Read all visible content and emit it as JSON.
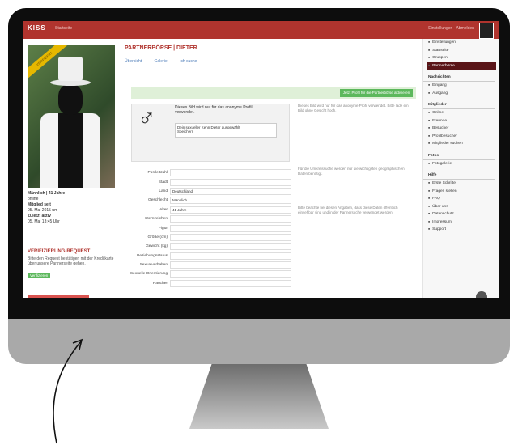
{
  "topbar": {
    "logo": "KISS",
    "nav": "Startseite",
    "right": "Einstellungen · Abmelden"
  },
  "profile": {
    "ribbon": "VERIFIZIERT",
    "meta": [
      {
        "label": "Männlich | 41 Jahre",
        "value": "online"
      },
      {
        "label": "Mitglied seit",
        "value": "05. Mai 2015 um"
      },
      {
        "label": "Zuletzt aktiv",
        "value": "05. Mai 13:45 Uhr"
      }
    ],
    "verification": {
      "title": "VERIFIZIERUNG-REQUEST",
      "text": "Bitte den Request bestätigen mit der Kreditkarte über unsere Partnerseite gehen.",
      "button": "Verifizieren"
    }
  },
  "main": {
    "title": "PARTNERBÖRSE | DIETER",
    "tabs": [
      "Übersicht",
      "Galerie",
      "Ich suche"
    ],
    "green_button": "Jetzt Profil für die Partnerbörse aktivieren",
    "anon_text": "Dieses Bild wird nur für das anonyme Profil verwendet.",
    "tagline": "Dein sexueller Kenn Dieter ausgewählt",
    "tagline_sub": "Speichern",
    "help": [
      "Dieses Bild wird nur für das anonyme Profil verwendet. Bitte lade ein Bild ohne Gesicht hoch.",
      "Für die Umkreissuche werden nur die wichtigsten geographischen Daten benötigt.",
      "Bitte beachte bei diesen Angaben, dass diese Daten öffentlich einsehbar sind und in der Partnersuche verwendet werden."
    ],
    "fields": [
      {
        "label": "Postleitzahl",
        "value": ""
      },
      {
        "label": "Stadt",
        "value": ""
      },
      {
        "label": "Land",
        "value": "Deutschland"
      },
      {
        "label": "Geschlecht",
        "value": "Männlich"
      },
      {
        "label": "Alter",
        "value": "41 Jahre"
      },
      {
        "label": "Sternzeichen",
        "value": ""
      },
      {
        "label": "Figur",
        "value": ""
      },
      {
        "label": "Größe (cm)",
        "value": ""
      },
      {
        "label": "Gewicht (kg)",
        "value": ""
      },
      {
        "label": "Beziehungsstatus",
        "value": ""
      },
      {
        "label": "Sexualverhalten",
        "value": ""
      },
      {
        "label": "Sexuelle Orientierung",
        "value": ""
      },
      {
        "label": "Raucher",
        "value": ""
      }
    ]
  },
  "sidebar": {
    "top_items": [
      "Einstellungen",
      "Startseite",
      "Gruppen",
      "Partnerbörse"
    ],
    "active_index": 3,
    "sections": [
      {
        "title": "Nachrichten",
        "items": [
          "Eingang",
          "Ausgang"
        ]
      },
      {
        "title": "Mitglieder",
        "items": [
          "Online",
          "Freunde",
          "Besucher",
          "Profilbesucher",
          "Mitglieder suchen"
        ]
      },
      {
        "title": "Fotos",
        "items": [
          "Fotogalerie"
        ]
      },
      {
        "title": "Hilfe",
        "items": [
          "Erste Schritte",
          "Fragen stellen",
          "FAQ",
          "Über uns",
          "Datenschutz",
          "Impressum",
          "Support"
        ]
      }
    ]
  }
}
